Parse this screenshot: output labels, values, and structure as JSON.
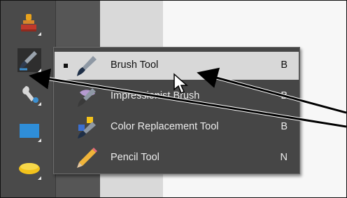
{
  "menu": {
    "items": [
      {
        "label": "Brush Tool",
        "shortcut": "B",
        "active": true,
        "icon": "brush-icon"
      },
      {
        "label": "Impressionist Brush",
        "shortcut": "B",
        "active": false,
        "icon": "impressionist-brush-icon"
      },
      {
        "label": "Color Replacement Tool",
        "shortcut": "B",
        "active": false,
        "icon": "color-replacement-icon"
      },
      {
        "label": "Pencil Tool",
        "shortcut": "N",
        "active": false,
        "icon": "pencil-icon"
      }
    ]
  },
  "toolbar": {
    "tools": [
      "stamp-icon",
      "eraser-icon",
      "brush-icon",
      "smart-brush-icon",
      "shape-icon",
      "sponge-icon"
    ]
  },
  "colors": {
    "toolbar_bg": "#4a4a4a",
    "menu_bg": "#464646",
    "menu_highlight": "#d8d8d8",
    "menu_text": "#ececec"
  }
}
